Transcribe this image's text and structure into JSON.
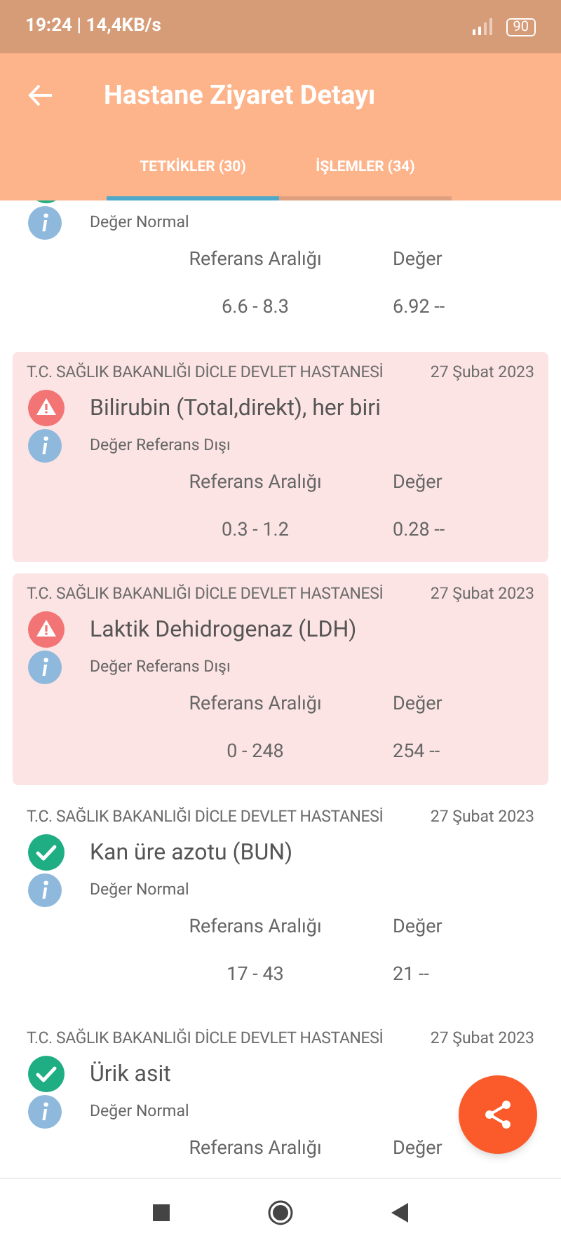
{
  "status_bar": {
    "time": "19:24 | 14,4KB/s",
    "battery": "90"
  },
  "header": {
    "title": "Hastane Ziyaret Detayı"
  },
  "tabs": [
    {
      "label": "TETKİKLER (30)",
      "selected": true
    },
    {
      "label": "İŞLEMLER (34)",
      "selected": false
    }
  ],
  "results": [
    {
      "kind": "normal",
      "note": "Değer Normal",
      "range_label": "Referans Aralığı",
      "value_label": "Değer",
      "range": "6.6 - 8.3",
      "value": "6.92 --"
    },
    {
      "kind": "abnormal",
      "hospital": "T.C. SAĞLIK BAKANLIĞI DİCLE DEVLET HASTANESİ",
      "date": "27 Şubat 2023",
      "test": "Bilirubin (Total,direkt), her biri",
      "note": "Değer Referans Dışı",
      "range_label": "Referans Aralığı",
      "value_label": "Değer",
      "range": "0.3 - 1.2",
      "value": "0.28 --"
    },
    {
      "kind": "abnormal",
      "hospital": "T.C. SAĞLIK BAKANLIĞI DİCLE DEVLET HASTANESİ",
      "date": "27 Şubat 2023",
      "test": "Laktik Dehidrogenaz (LDH)",
      "note": "Değer Referans Dışı",
      "range_label": "Referans Aralığı",
      "value_label": "Değer",
      "range": "0 - 248",
      "value": "254 --"
    },
    {
      "kind": "normal",
      "hospital": "T.C. SAĞLIK BAKANLIĞI DİCLE DEVLET HASTANESİ",
      "date": "27 Şubat 2023",
      "test": "Kan üre azotu (BUN)",
      "note": "Değer Normal",
      "range_label": "Referans Aralığı",
      "value_label": "Değer",
      "range": "17 - 43",
      "value": "21 --"
    },
    {
      "kind": "normal",
      "hospital": "T.C. SAĞLIK BAKANLIĞI DİCLE DEVLET HASTANESİ",
      "date": "27 Şubat 2023",
      "test": "Ürik asit",
      "note": "Değer Normal",
      "range_label": "Referans Aralığı",
      "value_label": "Değer"
    }
  ]
}
